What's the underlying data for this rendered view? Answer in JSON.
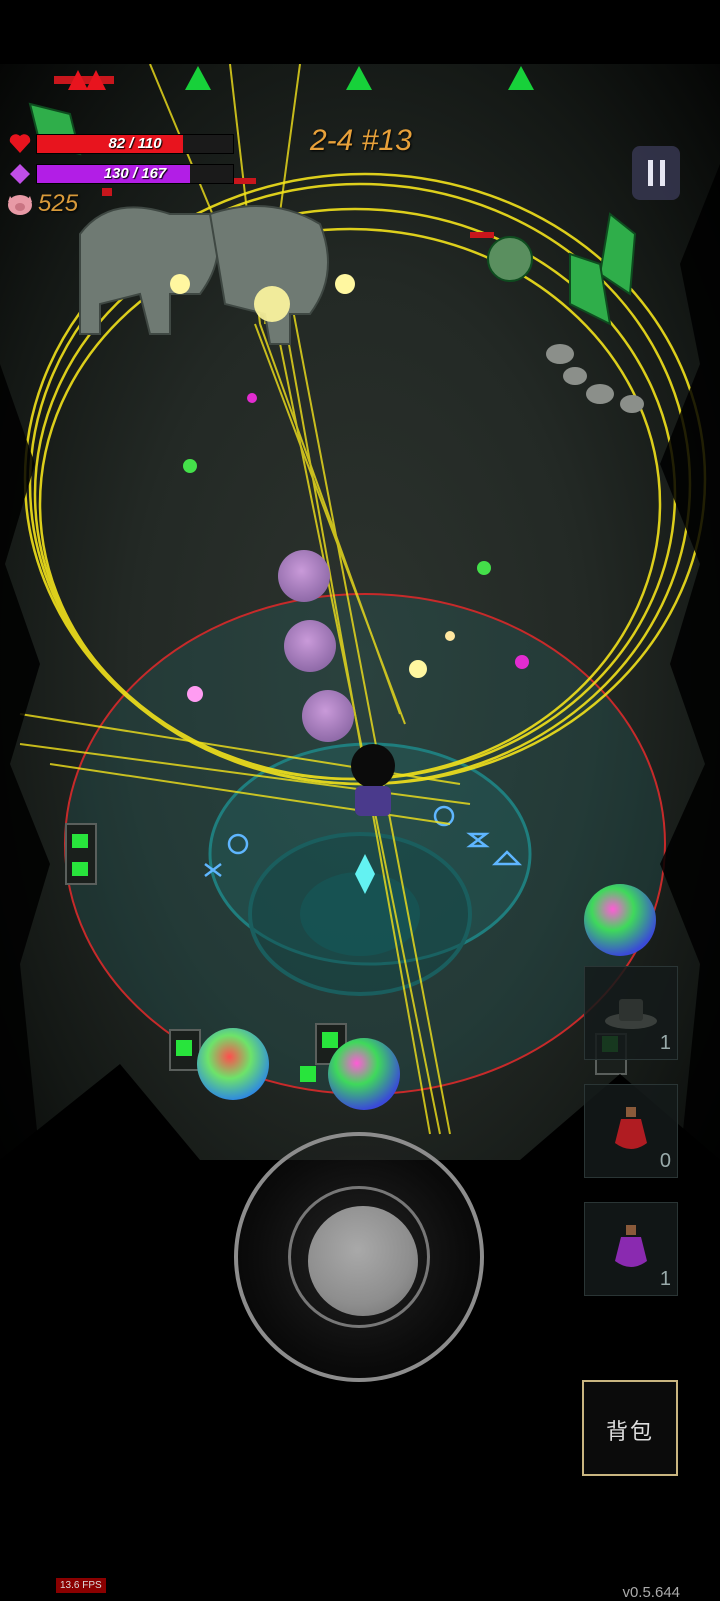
{
  "hud": {
    "hp": {
      "text": "82 / 110",
      "current": 82,
      "max": 110,
      "color": "#e8141e"
    },
    "mp": {
      "text": "130 / 167",
      "current": 130,
      "max": 167,
      "color": "#b21ee6"
    },
    "coins": "525",
    "stage": "2-4 #13"
  },
  "icons": {
    "heart": "heart-icon",
    "gem": "gem-icon",
    "pig": "pig-icon",
    "pause": "pause-icon"
  },
  "inventory": {
    "slots": [
      {
        "name": "hat",
        "count": "1"
      },
      {
        "name": "red-potion",
        "count": "0"
      },
      {
        "name": "purple-potion",
        "count": "1"
      }
    ]
  },
  "bag_button": {
    "label": "背包"
  },
  "footer": {
    "fps": "13.6 FPS",
    "version": "v0.5.644"
  },
  "colors": {
    "accent_gold": "#e8a13a",
    "laser": "#f2e21c",
    "enemy_marker": "#17d13a"
  }
}
